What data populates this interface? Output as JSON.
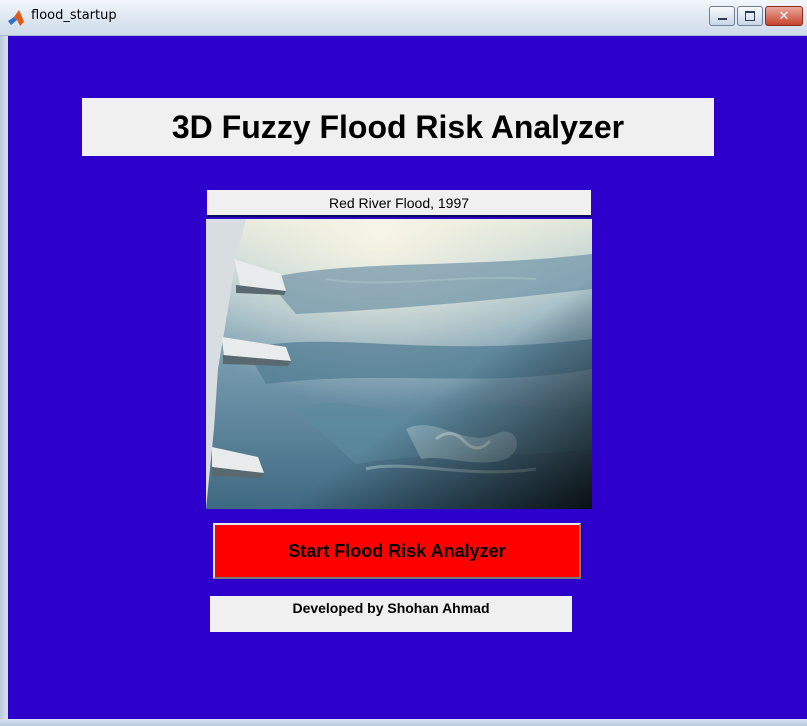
{
  "window": {
    "title": "flood_startup",
    "buttons": {
      "minimize": "minimize",
      "maximize": "maximize",
      "close": "close"
    }
  },
  "colors": {
    "figure_background": "#2d00cc",
    "panel_background": "#f0f0f0",
    "start_button": "#ff0000"
  },
  "main": {
    "title": "3D Fuzzy Flood Risk Analyzer",
    "image_caption": "Red River Flood, 1997",
    "start_button_label": "Start Flood Risk Analyzer",
    "credit": "Developed by Shohan Ahmad"
  },
  "icons": {
    "app": "matlab-icon",
    "close": "close-icon",
    "minimize": "minimize-icon",
    "maximize": "maximize-icon"
  }
}
